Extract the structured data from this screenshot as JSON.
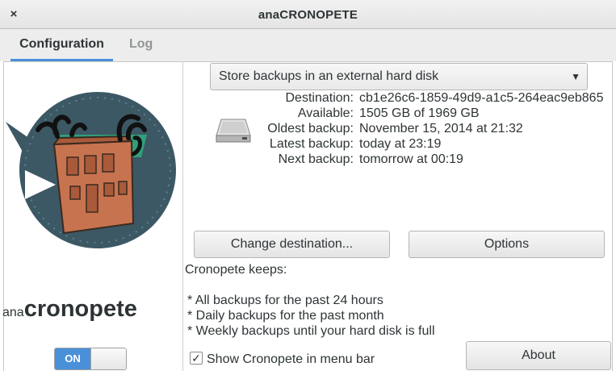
{
  "window": {
    "title": "anaCRONOPETE",
    "close_icon": "×"
  },
  "tabs": [
    {
      "label": "Configuration",
      "active": true
    },
    {
      "label": "Log",
      "active": false
    }
  ],
  "sidebar": {
    "brand_prefix": "ana",
    "brand_name": "cronopete",
    "switch_label": "ON",
    "switch_state": "on"
  },
  "backup_mode": {
    "selected": "Store backups in an external hard disk"
  },
  "info": {
    "destination": {
      "label": "Destination:",
      "value": "cb1e26c6-1859-49d9-a1c5-264eac9eb865"
    },
    "available": {
      "label": "Available:",
      "value": "1505 GB of 1969 GB"
    },
    "oldest": {
      "label": "Oldest backup:",
      "value": "November 15, 2014 at 21:32"
    },
    "latest": {
      "label": "Latest backup:",
      "value": "today at 23:19"
    },
    "next": {
      "label": "Next backup:",
      "value": "tomorrow at 00:19"
    }
  },
  "buttons": {
    "change_destination": "Change destination...",
    "options": "Options",
    "about": "About"
  },
  "keeps": {
    "heading": "Cronopete keeps:",
    "line1": "* All backups for the past 24 hours",
    "line2": "* Daily backups for the past month",
    "line3": "* Weekly backups until your hard disk is full"
  },
  "menu_bar_checkbox": {
    "label": "Show Cronopete in menu bar",
    "checked": true
  },
  "colors": {
    "accent": "#4a90d9",
    "logo_circle": "#3d5865",
    "house": "#c8734f",
    "smoke": "#111111",
    "glow": "#2fa07a"
  }
}
